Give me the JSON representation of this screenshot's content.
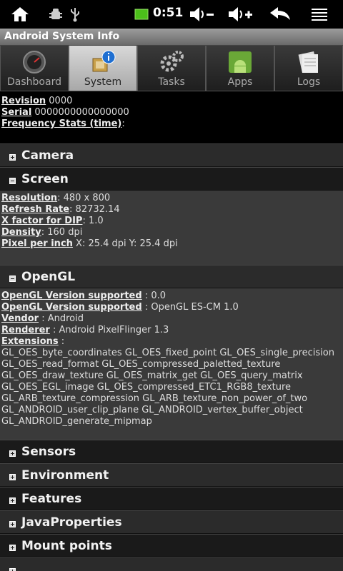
{
  "statusbar": {
    "time": "0:51",
    "icons": [
      "home-icon",
      "debug-icon",
      "usb-icon",
      "battery-icon",
      "volume-down-icon",
      "volume-up-icon",
      "back-icon",
      "menu-icon"
    ]
  },
  "app": {
    "title": "Android System Info"
  },
  "tabs": [
    {
      "label": "Dashboard",
      "icon": "dashboard-icon"
    },
    {
      "label": "System",
      "icon": "system-icon"
    },
    {
      "label": "Tasks",
      "icon": "gears-icon"
    },
    {
      "label": "Apps",
      "icon": "android-icon"
    },
    {
      "label": "Logs",
      "icon": "logs-icon"
    }
  ],
  "top_info": [
    {
      "key": "Revision",
      "value": " 0000"
    },
    {
      "key": "Serial",
      "value": " 0000000000000000"
    },
    {
      "key": "Frequency Stats (time)",
      "value": ":"
    }
  ],
  "sections": {
    "camera": "Camera",
    "screen": "Screen",
    "opengl": "OpenGL",
    "sensors": "Sensors",
    "environment": "Environment",
    "features": "Features",
    "javaproperties": "JavaProperties",
    "mountpoints": "Mount points"
  },
  "screen": [
    {
      "key": "Resolution",
      "value": ": 480 x 800"
    },
    {
      "key": "Refresh Rate",
      "value": ": 82732.14"
    },
    {
      "key": "X factor for DIP",
      "value": ": 1.0"
    },
    {
      "key": "Density",
      "value": ": 160 dpi"
    },
    {
      "key": "Pixel per inch",
      "value": " X: 25.4 dpi Y: 25.4 dpi"
    }
  ],
  "opengl": [
    {
      "key": "OpenGL Version supported",
      "value": " : 0.0"
    },
    {
      "key": "OpenGL Version supported",
      "value": " : OpenGL ES-CM 1.0"
    },
    {
      "key": "Vendor",
      "value": " : Android"
    },
    {
      "key": "Renderer",
      "value": " : Android PixelFlinger 1.3"
    },
    {
      "key": "Extensions",
      "value": " :"
    }
  ],
  "extensions": [
    "GL_OES_byte_coordinates GL_OES_fixed_point GL_OES_single_precision",
    "GL_OES_read_format GL_OES_compressed_paletted_texture",
    "GL_OES_draw_texture GL_OES_matrix_get GL_OES_query_matrix",
    "GL_OES_EGL_image GL_OES_compressed_ETC1_RGB8_texture",
    "GL_ARB_texture_compression GL_ARB_texture_non_power_of_two",
    "GL_ANDROID_user_clip_plane GL_ANDROID_vertex_buffer_object",
    "GL_ANDROID_generate_mipmap"
  ]
}
